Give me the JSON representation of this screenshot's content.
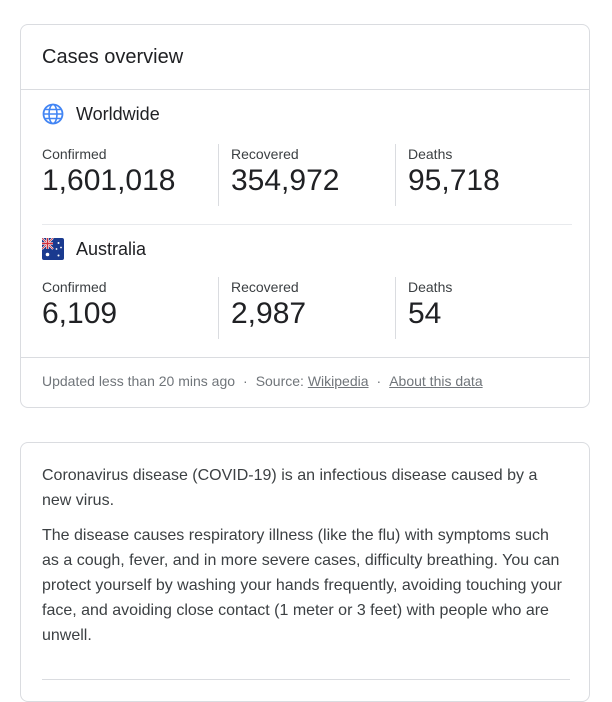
{
  "overview": {
    "title": "Cases overview",
    "regions": [
      {
        "name": "Worldwide",
        "icon": "globe-icon",
        "stats": [
          {
            "label": "Confirmed",
            "value": "1,601,018"
          },
          {
            "label": "Recovered",
            "value": "354,972"
          },
          {
            "label": "Deaths",
            "value": "95,718"
          }
        ]
      },
      {
        "name": "Australia",
        "icon": "australia-flag-icon",
        "stats": [
          {
            "label": "Confirmed",
            "value": "6,109"
          },
          {
            "label": "Recovered",
            "value": "2,987"
          },
          {
            "label": "Deaths",
            "value": "54"
          }
        ]
      }
    ],
    "footer": {
      "updated": "Updated less than 20 mins ago",
      "separator": "·",
      "source_label": "Source:",
      "source_link": "Wikipedia",
      "about_link": "About this data"
    }
  },
  "info": {
    "paragraph_1": "Coronavirus disease (COVID-19) is an infectious disease caused by a new virus.",
    "paragraph_2": "The disease causes respiratory illness (like the flu) with symptoms such as a cough, fever, and in more severe cases, difficulty breathing. You can protect yourself by washing your hands frequently, avoiding touching your face, and avoiding close contact (1 meter or 3 feet) with people who are unwell."
  },
  "colors": {
    "border": "#dadce0",
    "text": "#202124",
    "muted": "#70757a",
    "globe": "#4285f4"
  }
}
